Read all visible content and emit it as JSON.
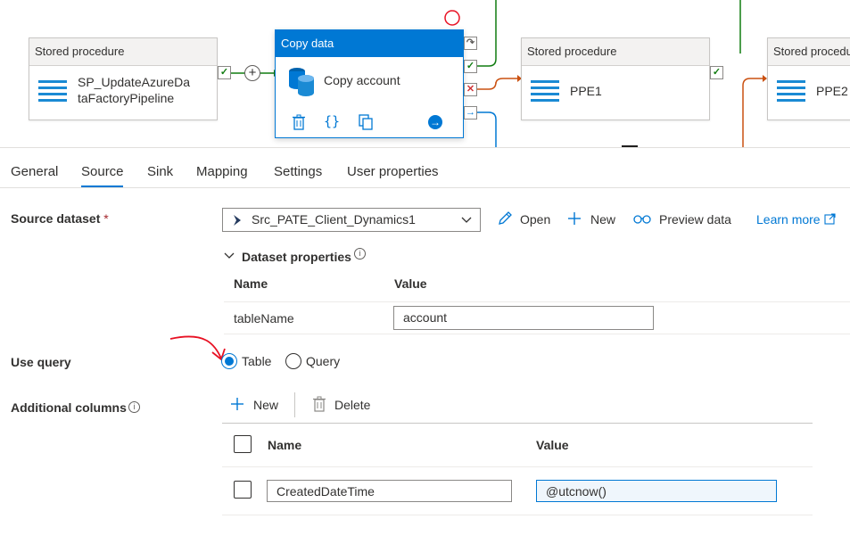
{
  "pipeline": {
    "activities": [
      {
        "type": "Stored procedure",
        "name_line1": "SP_UpdateAzureDa",
        "name_line2": "taFactoryPipeline"
      },
      {
        "type": "Copy data",
        "name": "Copy account"
      },
      {
        "type": "Stored procedure",
        "name": "PPE1"
      },
      {
        "type": "Stored procedu",
        "name": "PPE2"
      }
    ],
    "port_success": "✓",
    "port_fail": "✕",
    "port_completion": "→",
    "port_skip": "↷",
    "add_symbol": "+"
  },
  "tabs": [
    {
      "label": "General"
    },
    {
      "label": "Source"
    },
    {
      "label": "Sink"
    },
    {
      "label": "Mapping"
    },
    {
      "label": "Settings"
    },
    {
      "label": "User properties"
    }
  ],
  "source": {
    "dataset_label": "Source dataset",
    "required_mark": "*",
    "dataset_value": "Src_PATE_Client_Dynamics1",
    "open_label": "Open",
    "new_label": "New",
    "preview_label": "Preview data",
    "learn_more_label": "Learn more",
    "dataset_properties": {
      "title": "Dataset properties",
      "name_header": "Name",
      "value_header": "Value",
      "rows": [
        {
          "name": "tableName",
          "value": "account"
        }
      ]
    },
    "use_query": {
      "label": "Use query",
      "options": [
        {
          "label": "Table",
          "selected": true
        },
        {
          "label": "Query",
          "selected": false
        }
      ]
    },
    "additional_columns": {
      "label": "Additional columns",
      "new_label": "New",
      "delete_label": "Delete",
      "name_header": "Name",
      "value_header": "Value",
      "rows": [
        {
          "name": "CreatedDateTime",
          "value": "@utcnow()"
        }
      ]
    }
  },
  "colors": {
    "accent": "#0078d4",
    "success": "#107c10",
    "failure": "#d13438",
    "annotation": "#e81123"
  }
}
